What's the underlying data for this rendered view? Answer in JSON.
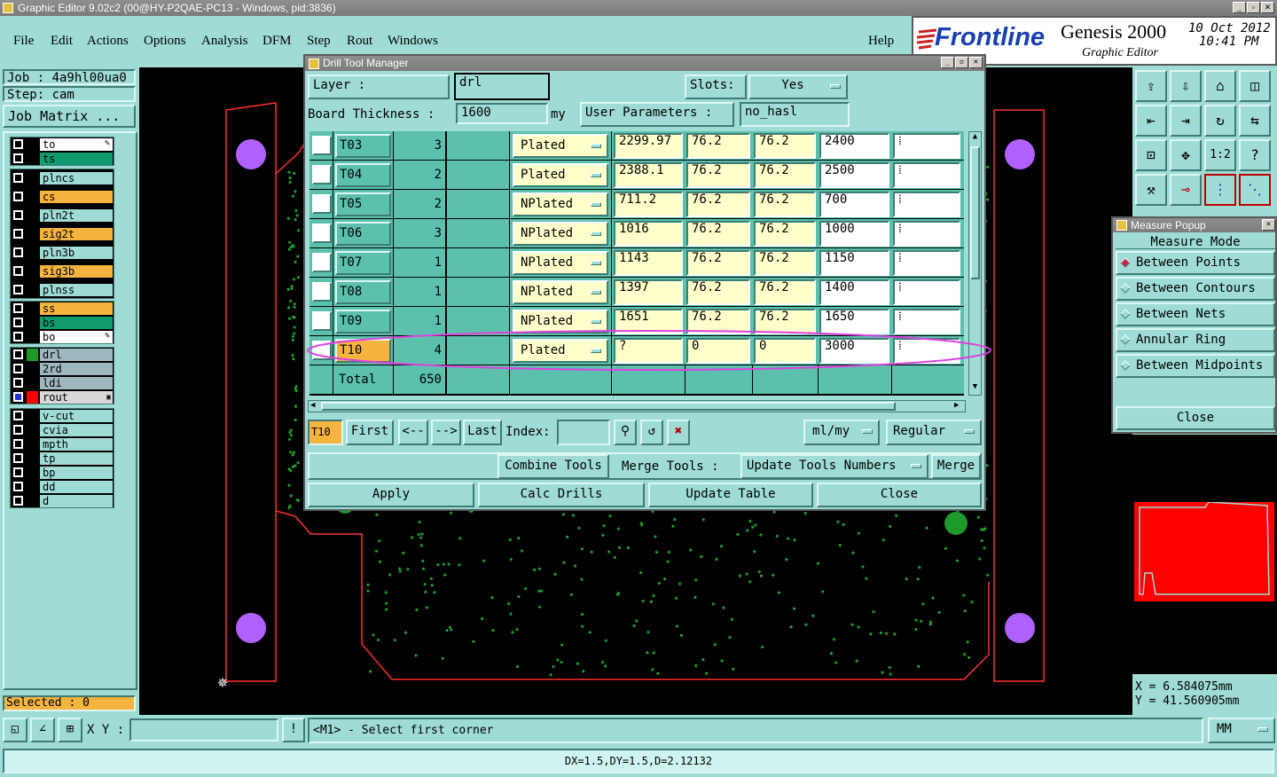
{
  "window": {
    "title": "Graphic Editor 9.02c2 (00@HY-P2QAE-PC13 - Windows, pid:3836)"
  },
  "menu": [
    "File",
    "Edit",
    "Actions",
    "Options",
    "Analysis",
    "DFM",
    "Step",
    "Rout",
    "Windows"
  ],
  "help": "Help",
  "logo": {
    "brand": "Frontline",
    "product": "Genesis 2000",
    "subtitle": "Graphic Editor",
    "date": "10 Oct 2012",
    "time": "10:41 PM"
  },
  "job": {
    "job": "Job : 4a9hl00ua0",
    "step": "Step: cam",
    "matrix_button": "Job Matrix ..."
  },
  "layers": {
    "group1": [
      {
        "name": "to",
        "bg": "#ffffff",
        "mark": true
      },
      {
        "name": "ts",
        "bg": "#0f9b6e"
      },
      {
        "name": "plncs",
        "bg": "#9fdcd5"
      },
      {
        "name": "cs",
        "bg": "#f5b43f"
      },
      {
        "name": "pln2t",
        "bg": "#9fdcd5"
      },
      {
        "name": "sig2t",
        "bg": "#f5b43f"
      },
      {
        "name": "pln3b",
        "bg": "#9fdcd5"
      },
      {
        "name": "sig3b",
        "bg": "#f5b43f"
      },
      {
        "name": "plnss",
        "bg": "#9fdcd5"
      }
    ],
    "group2": [
      {
        "name": "ss",
        "bg": "#f5b43f"
      },
      {
        "name": "bs",
        "bg": "#0f9b6e"
      },
      {
        "name": "bo",
        "bg": "#ffffff",
        "mark": true
      }
    ],
    "group3": [
      {
        "name": "drl",
        "bg": "#9fb8bf",
        "swatch": "#1e9a2a"
      },
      {
        "name": "2rd",
        "bg": "#9fb8bf"
      },
      {
        "name": "ldi",
        "bg": "#9fb8bf"
      },
      {
        "name": "rout",
        "bg": "#d8d8d8",
        "swatch": "#ff0000",
        "work": true
      }
    ],
    "group4": [
      {
        "name": "v-cut",
        "bg": "#9fdcd5"
      },
      {
        "name": "cvia",
        "bg": "#9fdcd5"
      },
      {
        "name": "mpth",
        "bg": "#9fdcd5"
      },
      {
        "name": "tp",
        "bg": "#9fdcd5"
      },
      {
        "name": "bp",
        "bg": "#9fdcd5"
      },
      {
        "name": "dd",
        "bg": "#9fdcd5"
      },
      {
        "name": "d",
        "bg": "#9fdcd5"
      }
    ]
  },
  "selected": "Selected : 0",
  "dialog": {
    "title": "Drill Tool Manager",
    "layer_label": "Layer           :",
    "layer_value": "drl",
    "slots_label": "Slots:",
    "slots_value": "Yes",
    "thickness_label": "Board Thickness :",
    "thickness_value": "1600",
    "thickness_unit": "my",
    "user_params_label": "User Parameters :",
    "user_params_value": "no_hasl",
    "rows": [
      {
        "tool": "T03",
        "count": "3",
        "type": "Plated",
        "d1": "2299.97",
        "d2": "76.2",
        "d3": "76.2",
        "finish": "2400"
      },
      {
        "tool": "T04",
        "count": "2",
        "type": "Plated",
        "d1": "2388.1",
        "d2": "76.2",
        "d3": "76.2",
        "finish": "2500"
      },
      {
        "tool": "T05",
        "count": "2",
        "type": "NPlated",
        "d1": "711.2",
        "d2": "76.2",
        "d3": "76.2",
        "finish": "700"
      },
      {
        "tool": "T06",
        "count": "3",
        "type": "NPlated",
        "d1": "1016",
        "d2": "76.2",
        "d3": "76.2",
        "finish": "1000"
      },
      {
        "tool": "T07",
        "count": "1",
        "type": "NPlated",
        "d1": "1143",
        "d2": "76.2",
        "d3": "76.2",
        "finish": "1150"
      },
      {
        "tool": "T08",
        "count": "1",
        "type": "NPlated",
        "d1": "1397",
        "d2": "76.2",
        "d3": "76.2",
        "finish": "1400"
      },
      {
        "tool": "T09",
        "count": "1",
        "type": "NPlated",
        "d1": "1651",
        "d2": "76.2",
        "d3": "76.2",
        "finish": "1650"
      },
      {
        "tool": "T10",
        "count": "4",
        "type": "Plated",
        "d1": "?",
        "d2": "0",
        "d3": "0",
        "finish": "3000",
        "highlight": true
      }
    ],
    "total_label": "Total",
    "total_value": "650",
    "current_tool": "T10",
    "nav": {
      "first": "First",
      "prev": "<--",
      "next": "-->",
      "last": "Last",
      "index_label": "Index:"
    },
    "units": "ml/my",
    "mode": "Regular",
    "combine": "Combine Tools",
    "merge_label": "Merge Tools :",
    "merge_option": "Update Tools Numbers",
    "merge": "Merge",
    "apply": "Apply",
    "calc": "Calc Drills",
    "update": "Update Table",
    "close": "Close"
  },
  "measure": {
    "title": "Measure Popup",
    "header": "Measure Mode",
    "options": [
      "Between Points",
      "Between Contours",
      "Between Nets",
      "Annular Ring",
      "Between Midpoints"
    ],
    "selected_index": 0,
    "close": "Close"
  },
  "coords": {
    "x": "X  =  6.584075mm",
    "y": "Y  = 41.560905mm"
  },
  "status": {
    "xy_label": "X Y :",
    "prompt": "<M1> - Select first corner",
    "units": "MM"
  },
  "bottom": "DX=1.5,DY=1.5,D=2.12132",
  "colors": {
    "accent_highlight": "#e040e0",
    "route": "#ff3030",
    "pad": "#b060ff"
  }
}
